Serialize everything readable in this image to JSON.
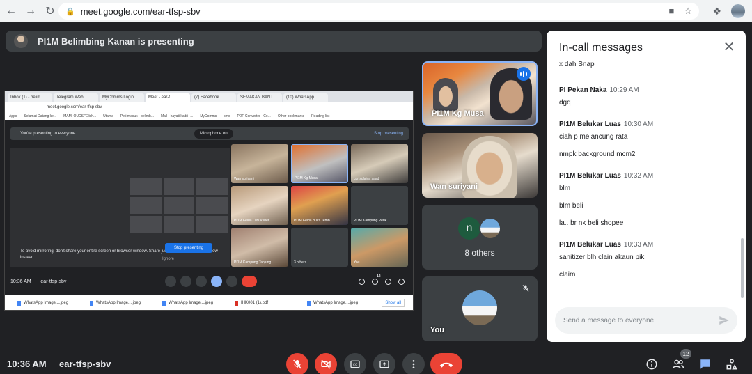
{
  "browser": {
    "url": "meet.google.com/ear-tfsp-sbv"
  },
  "banner": {
    "text": "PI1M Belimbing Kanan is presenting"
  },
  "shared_screen": {
    "tabs": [
      "Inbox (1) - belim...",
      "Telegram Web",
      "MyComms Login",
      "Meet - ear-t...",
      "(7) Facebook",
      "SEMAKAN BANT...",
      "(10) WhatsApp"
    ],
    "url": "meet.google.com/ear-tfsp-sbv",
    "bookmarks": [
      "Apps",
      "Selamat Datang ke...",
      "MAMI OUCS \"Elich...",
      "Utama",
      "Peti masuk - belimb...",
      "Mail - hayati kadri -...",
      "MyComms",
      "cms",
      "PDF Converter - Co...",
      "Other bookmarks",
      "Reading list"
    ],
    "presenting_text": "You're presenting to everyone",
    "mic_label": "Microphone on",
    "stop_label": "Stop presenting",
    "mirror_warning": "To avoid mirroring, don't share your entire screen or browser window. Share just a tab or a different window instead.",
    "stop_button": "Stop presenting",
    "ignore_button": "Ignore",
    "tiles": [
      "Wan suriyani",
      "PI1M Kg Musa",
      "cdr sulaina saad",
      "PI1M Felda Lubuk Mer...",
      "PI1M Felda Bukit Temb...",
      "PI1M Kampung Perik",
      "PI1M Kampung Tanjung",
      "3 others",
      "You"
    ],
    "footer_time": "10:36 AM",
    "footer_code": "ear-tfsp-sbv",
    "people_count": "12",
    "downloads": [
      "WhatsApp Image....jpeg",
      "WhatsApp Image....jpeg",
      "WhatsApp Image....jpeg",
      "IHK001 (1).pdf",
      "WhatsApp Image....jpeg"
    ],
    "show_all": "Show all"
  },
  "participants": [
    {
      "name": "PI1M Kg Musa"
    },
    {
      "name": "Wan suriyani"
    },
    {
      "initial": "n",
      "others": "8 others"
    },
    {
      "name": "You"
    }
  ],
  "chat": {
    "title": "In-call messages",
    "partial_top": "x dah Snap",
    "groups": [
      {
        "sender": "PI Pekan Naka",
        "time": "10:29 AM",
        "lines": [
          "dgq"
        ]
      },
      {
        "sender": "PI1M Belukar Luas",
        "time": "10:30 AM",
        "lines": [
          "ciah p melancung rata",
          "nmpk background mcm2"
        ]
      },
      {
        "sender": "PI1M Belukar Luas",
        "time": "10:32 AM",
        "lines": [
          "blm",
          "blm beli",
          "la.. br nk beli shopee"
        ]
      },
      {
        "sender": "PI1M Belukar Luas",
        "time": "10:33 AM",
        "lines": [
          "sanitizer blh clain akaun pik",
          "claim"
        ]
      }
    ],
    "input_placeholder": "Send a message to everyone"
  },
  "bottom": {
    "time": "10:36 AM",
    "code": "ear-tfsp-sbv",
    "people_badge": "12"
  }
}
